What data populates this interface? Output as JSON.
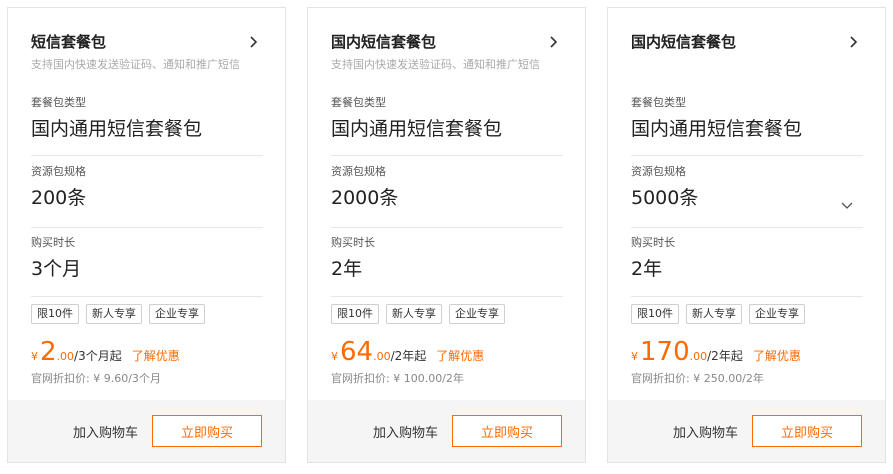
{
  "cards": [
    {
      "title": "短信套餐包",
      "description": "支持国内快速发送验证码、通知和推广短信",
      "type_label": "套餐包类型",
      "type_value": "国内通用短信套餐包",
      "spec_label": "资源包规格",
      "spec_value": "200条",
      "spec_has_dropdown": false,
      "duration_label": "购买时长",
      "duration_value": "3个月",
      "tags": [
        "限10件",
        "新人专享",
        "企业专享"
      ],
      "price_currency": "¥",
      "price_int": "2",
      "price_dec": ".00",
      "price_unit": "/3个月起",
      "discount_link": "了解优惠",
      "original_price": "官网折扣价: ¥ 9.60/3个月",
      "cart_label": "加入购物车",
      "buy_label": "立即购买"
    },
    {
      "title": "国内短信套餐包",
      "description": "支持国内快速发送验证码、通知和推广短信",
      "type_label": "套餐包类型",
      "type_value": "国内通用短信套餐包",
      "spec_label": "资源包规格",
      "spec_value": "2000条",
      "spec_has_dropdown": false,
      "duration_label": "购买时长",
      "duration_value": "2年",
      "tags": [
        "限10件",
        "新人专享",
        "企业专享"
      ],
      "price_currency": "¥",
      "price_int": "64",
      "price_dec": ".00",
      "price_unit": "/2年起",
      "discount_link": "了解优惠",
      "original_price": "官网折扣价: ¥ 100.00/2年",
      "cart_label": "加入购物车",
      "buy_label": "立即购买"
    },
    {
      "title": "国内短信套餐包",
      "description": "",
      "type_label": "套餐包类型",
      "type_value": "国内通用短信套餐包",
      "spec_label": "资源包规格",
      "spec_value": "5000条",
      "spec_has_dropdown": true,
      "duration_label": "购买时长",
      "duration_value": "2年",
      "tags": [
        "限10件",
        "新人专享",
        "企业专享"
      ],
      "price_currency": "¥",
      "price_int": "170",
      "price_dec": ".00",
      "price_unit": "/2年起",
      "discount_link": "了解优惠",
      "original_price": "官网折扣价: ¥ 250.00/2年",
      "cart_label": "加入购物车",
      "buy_label": "立即购买"
    }
  ],
  "colors": {
    "accent": "#ff6a00",
    "border": "#e3e3e3",
    "footer_bg": "#f5f5f5"
  },
  "icons": {
    "header_chevron": "chevron-right-icon",
    "spec_dropdown": "chevron-down-icon"
  }
}
